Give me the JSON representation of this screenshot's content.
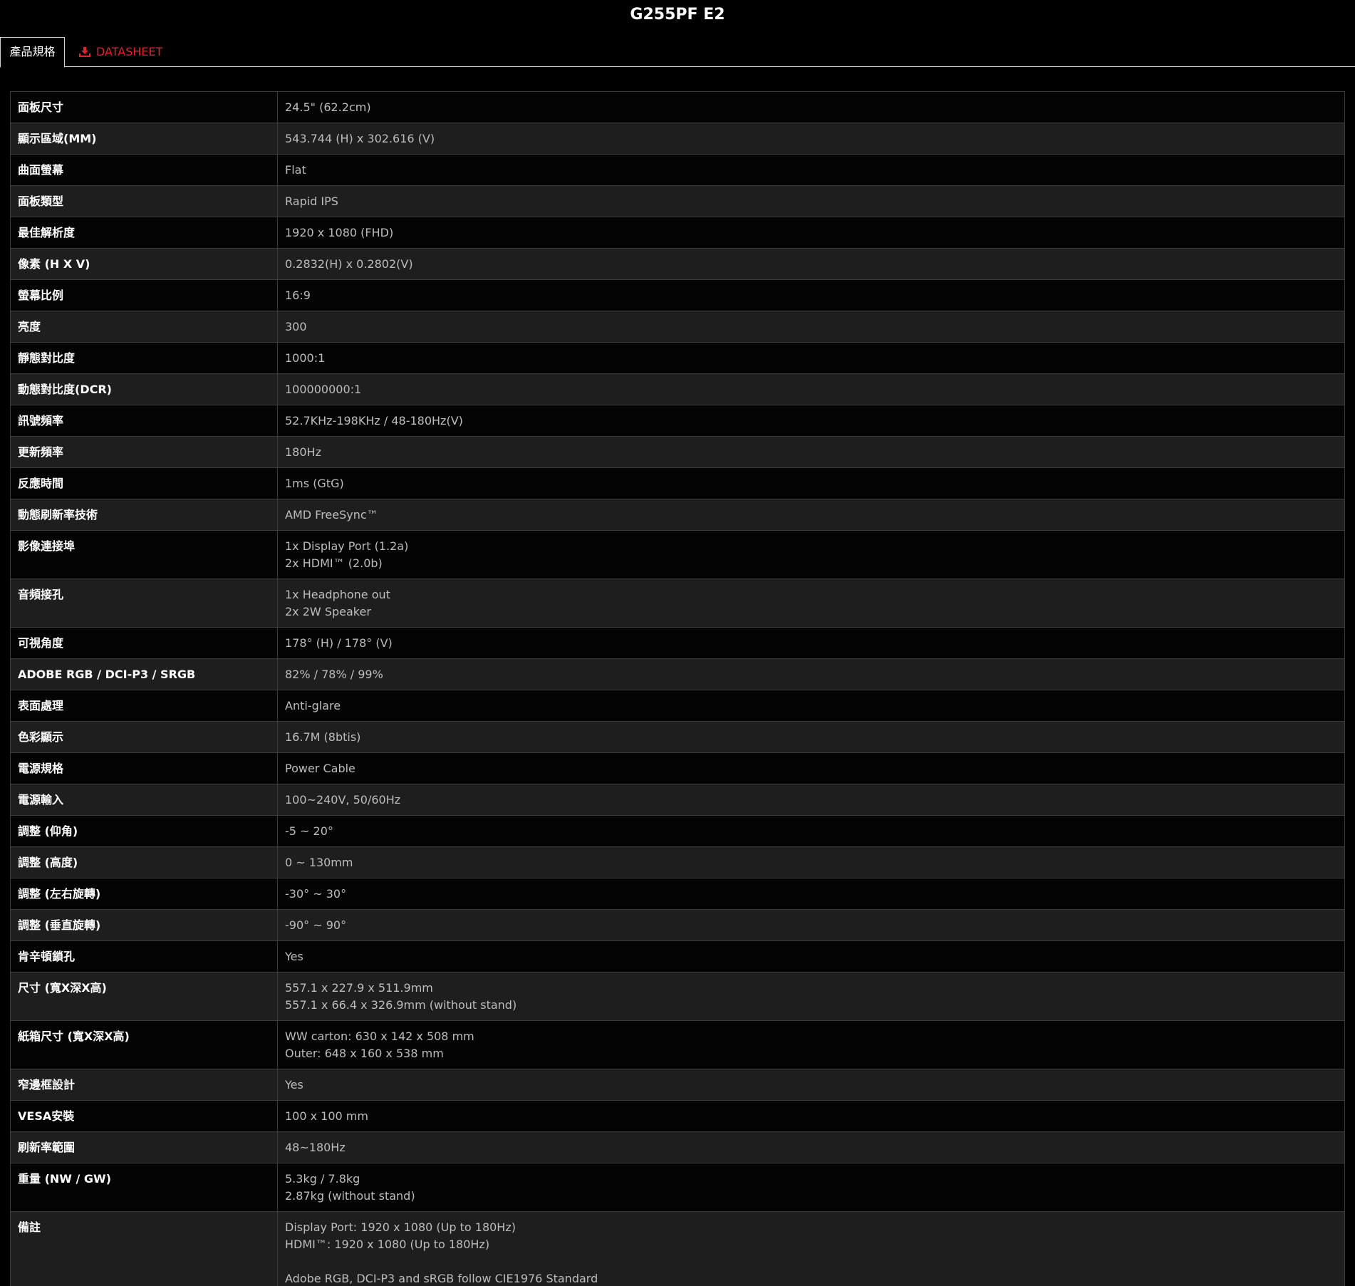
{
  "header": {
    "title": "G255PF E2"
  },
  "tabs": [
    {
      "label": "產品規格",
      "icon": ""
    },
    {
      "label": "DATASHEET",
      "icon": "download-icon"
    }
  ],
  "colors": {
    "accent": "#e8202a",
    "row_even": "#1f1e1f",
    "row_odd": "#040404"
  },
  "specs": [
    {
      "label": "面板尺寸",
      "lines": [
        "24.5\" (62.2cm)"
      ]
    },
    {
      "label": "顯示區域(MM)",
      "lines": [
        "543.744 (H) x 302.616 (V)"
      ]
    },
    {
      "label": "曲面螢幕",
      "lines": [
        "Flat"
      ]
    },
    {
      "label": "面板類型",
      "lines": [
        "Rapid IPS"
      ]
    },
    {
      "label": "最佳解析度",
      "lines": [
        "1920 x 1080 (FHD)"
      ]
    },
    {
      "label": "像素 (H X V)",
      "lines": [
        "0.2832(H) x 0.2802(V)"
      ]
    },
    {
      "label": "螢幕比例",
      "lines": [
        "16:9"
      ]
    },
    {
      "label": "亮度",
      "lines": [
        "300"
      ]
    },
    {
      "label": "靜態對比度",
      "lines": [
        "1000:1"
      ]
    },
    {
      "label": "動態對比度(DCR)",
      "lines": [
        "100000000:1"
      ]
    },
    {
      "label": "訊號頻率",
      "lines": [
        "52.7KHz-198KHz / 48-180Hz(V)"
      ]
    },
    {
      "label": "更新頻率",
      "lines": [
        "180Hz"
      ]
    },
    {
      "label": "反應時間",
      "lines": [
        "1ms (GtG)"
      ]
    },
    {
      "label": "動態刷新率技術",
      "lines": [
        "AMD FreeSync™"
      ]
    },
    {
      "label": "影像連接埠",
      "lines": [
        "1x Display Port (1.2a)",
        "2x HDMI™ (2.0b)"
      ]
    },
    {
      "label": "音頻接孔",
      "lines": [
        "1x Headphone out",
        "2x 2W Speaker"
      ]
    },
    {
      "label": "可視角度",
      "lines": [
        "178° (H) / 178° (V)"
      ]
    },
    {
      "label": "ADOBE RGB / DCI-P3 / SRGB",
      "lines": [
        "82% / 78% / 99%"
      ]
    },
    {
      "label": "表面處理",
      "lines": [
        "Anti-glare"
      ]
    },
    {
      "label": "色彩顯示",
      "lines": [
        "16.7M (8btis)"
      ]
    },
    {
      "label": "電源規格",
      "lines": [
        "Power Cable"
      ]
    },
    {
      "label": "電源輸入",
      "lines": [
        "100~240V, 50/60Hz"
      ]
    },
    {
      "label": "調整 (仰角)",
      "lines": [
        "-5 ~ 20°"
      ]
    },
    {
      "label": "調整 (高度)",
      "lines": [
        "0 ~ 130mm"
      ]
    },
    {
      "label": "調整 (左右旋轉)",
      "lines": [
        "-30° ~ 30°"
      ]
    },
    {
      "label": "調整 (垂直旋轉)",
      "lines": [
        "-90° ~ 90°"
      ]
    },
    {
      "label": "肯辛頓鎖孔",
      "lines": [
        "Yes"
      ]
    },
    {
      "label": "尺寸 (寬X深X高)",
      "lines": [
        "557.1 x 227.9 x 511.9mm",
        "557.1 x 66.4 x 326.9mm (without stand)"
      ]
    },
    {
      "label": "紙箱尺寸 (寬X深X高)",
      "lines": [
        "WW carton: 630 x 142 x 508 mm",
        "Outer: 648 x 160 x 538 mm"
      ]
    },
    {
      "label": "窄邊框設計",
      "lines": [
        "Yes"
      ]
    },
    {
      "label": "VESA安裝",
      "lines": [
        "100 x 100 mm"
      ]
    },
    {
      "label": "刷新率範圍",
      "lines": [
        "48~180Hz"
      ]
    },
    {
      "label": "重量 (NW / GW)",
      "lines": [
        "5.3kg / 7.8kg",
        "2.87kg (without stand)"
      ]
    },
    {
      "label": "備註",
      "lines": [
        "Display Port: 1920 x 1080 (Up to 180Hz)",
        "HDMI™: 1920 x 1080 (Up to 180Hz)",
        "",
        "Adobe RGB, DCI-P3 and sRGB follow CIE1976 Standard"
      ]
    }
  ]
}
